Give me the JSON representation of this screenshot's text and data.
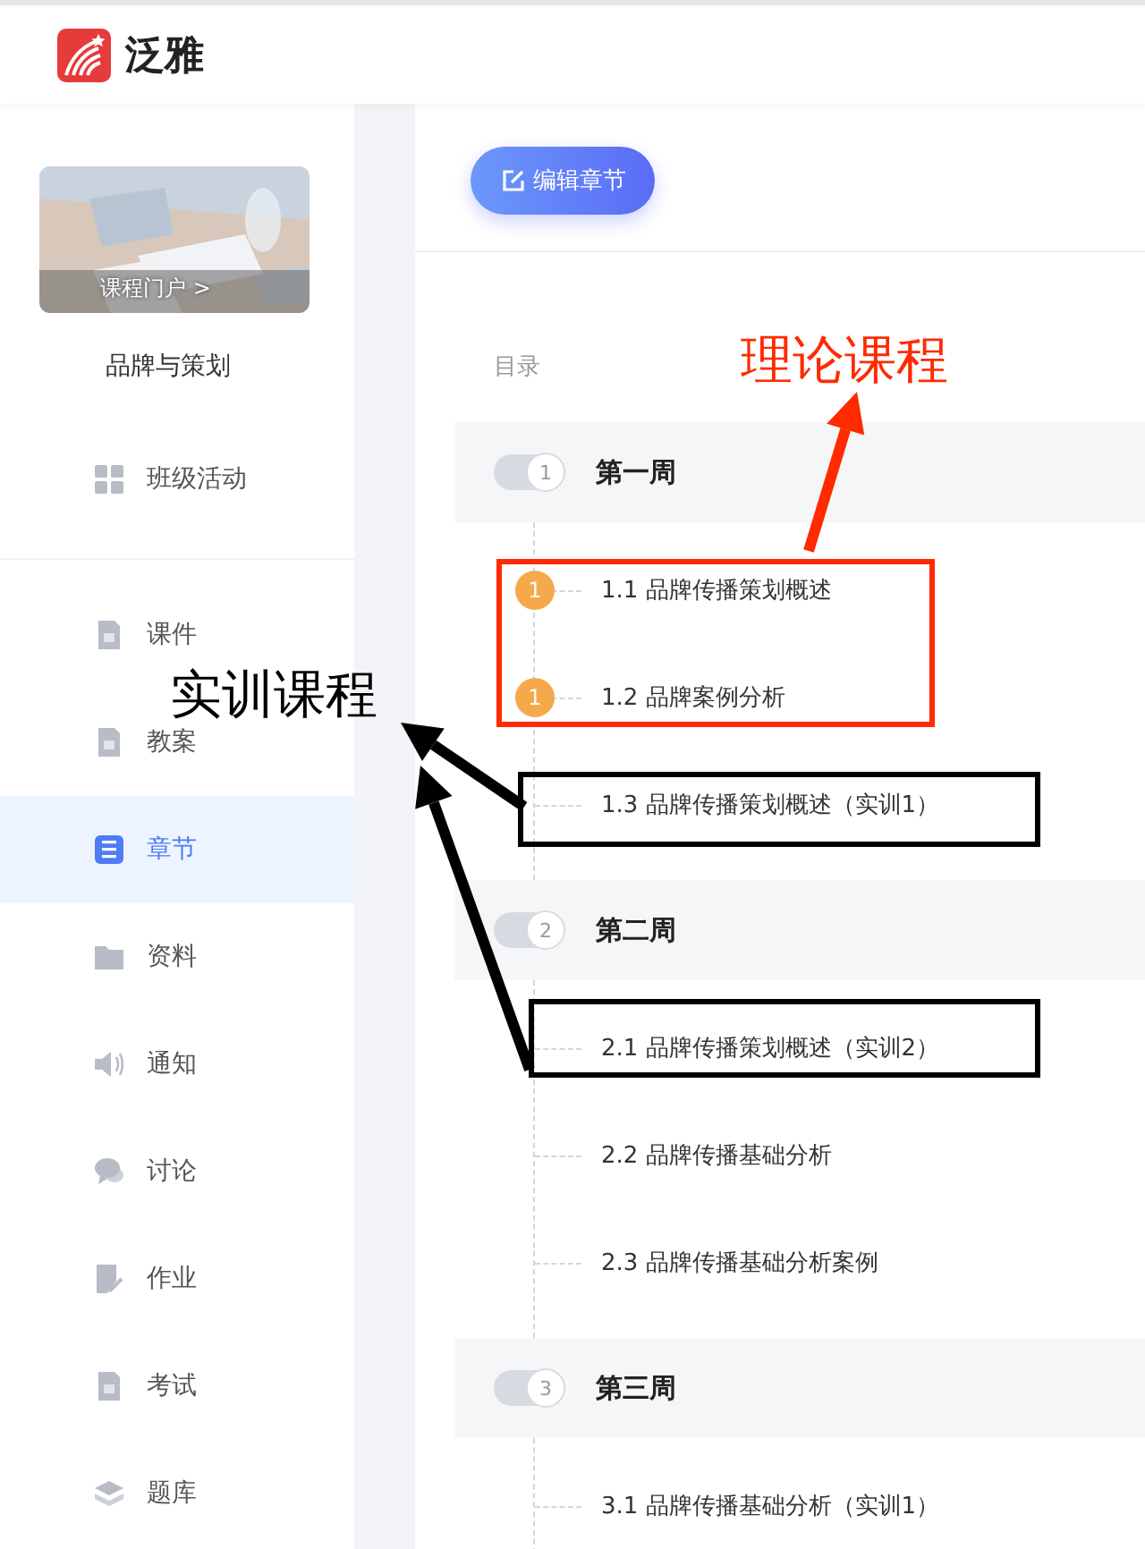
{
  "header": {
    "brand": "泛雅"
  },
  "course": {
    "portal_link": "课程门户 >",
    "name": "品牌与策划"
  },
  "sidebar": {
    "groups": [
      [
        {
          "label": "班级活动",
          "selected": false
        }
      ],
      [
        {
          "label": "课件",
          "selected": false
        },
        {
          "label": "教案",
          "selected": false
        },
        {
          "label": "章节",
          "selected": true
        },
        {
          "label": "资料",
          "selected": false
        },
        {
          "label": "通知",
          "selected": false
        },
        {
          "label": "讨论",
          "selected": false
        },
        {
          "label": "作业",
          "selected": false
        },
        {
          "label": "考试",
          "selected": false
        },
        {
          "label": "题库",
          "selected": false
        }
      ]
    ]
  },
  "main": {
    "edit_button": "编辑章节",
    "toc_label": "目录",
    "weeks": [
      {
        "number": "1",
        "title": "第一周",
        "lessons": [
          {
            "title": "1.1 品牌传播策划概述",
            "badge": "1"
          },
          {
            "title": "1.2 品牌案例分析",
            "badge": "1"
          },
          {
            "title": "1.3 品牌传播策划概述（实训1）"
          }
        ]
      },
      {
        "number": "2",
        "title": "第二周",
        "lessons": [
          {
            "title": "2.1 品牌传播策划概述（实训2）"
          },
          {
            "title": "2.2 品牌传播基础分析"
          },
          {
            "title": "2.3 品牌传播基础分析案例"
          }
        ]
      },
      {
        "number": "3",
        "title": "第三周",
        "lessons": [
          {
            "title": "3.1 品牌传播基础分析（实训1）"
          }
        ]
      }
    ]
  },
  "annotations": [
    {
      "kind": "theory",
      "label": "理论课程",
      "color": "#ff2a00"
    },
    {
      "kind": "practice",
      "label": "实训课程",
      "color": "#000000"
    }
  ]
}
